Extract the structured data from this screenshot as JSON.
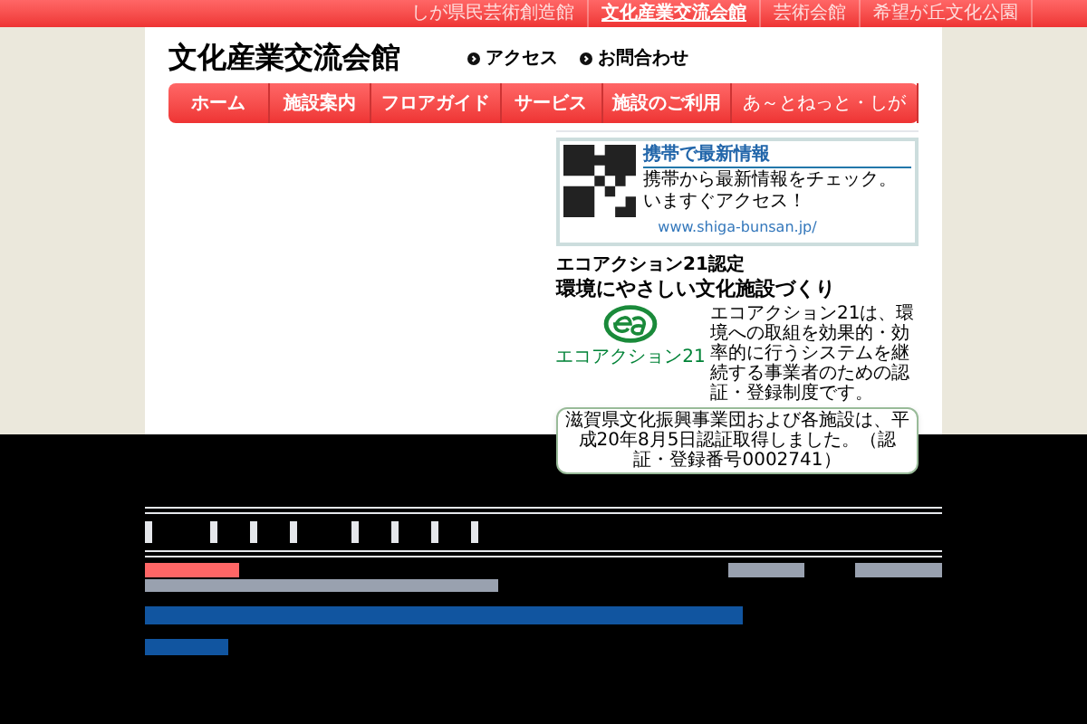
{
  "top_links": [
    {
      "label": "しが県民芸術創造館",
      "selected": false
    },
    {
      "label": "文化産業交流会館",
      "selected": true
    },
    {
      "label": "芸術会館",
      "selected": false
    },
    {
      "label": "希望が丘文化公園",
      "selected": false
    }
  ],
  "site_title": "文化産業交流会館",
  "header_links": [
    "アクセス",
    "お問合わせ"
  ],
  "nav": [
    "ホーム",
    "施設案内",
    "フロアガイド",
    "サービス",
    "施設のご利用",
    "あ～とねっと・しが"
  ],
  "mobile_box": {
    "heading": "携帯で最新情報",
    "text": "携帯から最新情報をチェック。いますぐアクセス！",
    "url": "www.shiga-bunsan.jp/"
  },
  "eco": {
    "caption": "エコアクション21認定",
    "heading": "環境にやさしい文化施設づくり",
    "logo_label": "エコアクション21",
    "text": "エコアクション21は、環境への取組を効果的・効率的に行うシステムを継続する事業者のための認証・登録制度です。",
    "notice": "滋賀県文化振興事業団および各施設は、平成20年8月5日認証取得しました。（認証・登録番号0002741）"
  }
}
